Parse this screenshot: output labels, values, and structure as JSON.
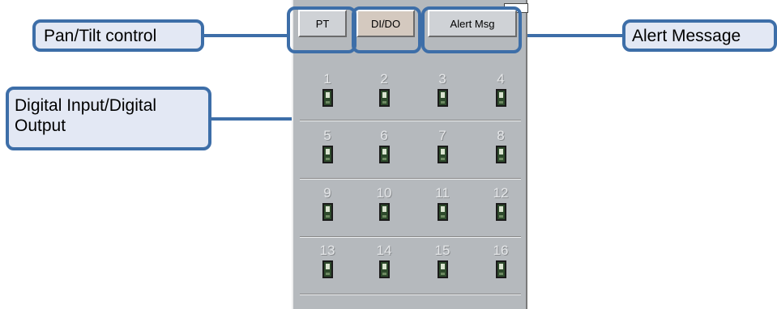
{
  "callouts": {
    "pan_tilt": "Pan/Tilt control",
    "dido_line1": "Digital  Input/Digital",
    "dido_line2": "Output",
    "alert": "Alert Message"
  },
  "tabs": {
    "pt": "PT",
    "dido": "DI/DO",
    "alert": "Alert Msg"
  },
  "io_channels": [
    "1",
    "2",
    "3",
    "4",
    "5",
    "6",
    "7",
    "8",
    "9",
    "10",
    "11",
    "12",
    "13",
    "14",
    "15",
    "16"
  ],
  "colors": {
    "callout_border": "#3d6ea8",
    "callout_fill": "#e3e8f4",
    "panel_bg": "#b5b9bd"
  }
}
